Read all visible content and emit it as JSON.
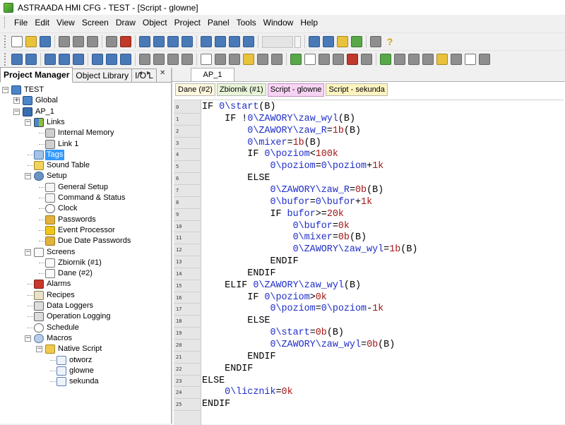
{
  "window": {
    "title": "ASTRAADA HMI CFG - TEST - [Script - glowne]"
  },
  "menu": {
    "items": [
      "File",
      "Edit",
      "View",
      "Screen",
      "Draw",
      "Object",
      "Project",
      "Panel",
      "Tools",
      "Window",
      "Help"
    ]
  },
  "toolbar1": {
    "icons": [
      "new-file-icon",
      "open-folder-icon",
      "save-icon",
      "cut-icon",
      "copy-icon",
      "paste-icon",
      "undo-icon",
      "redo-icon",
      "screen-add-icon",
      "screen-icon",
      "screen-copy-icon",
      "screen-edit-icon",
      "zoom-in-icon",
      "zoom-out-icon",
      "zoom-fit-icon",
      "hand-icon",
      "zoom-combo",
      "spin-icon",
      "download-icon",
      "upload-icon",
      "edit-icon",
      "simulate-icon",
      "print-icon",
      "help-icon"
    ]
  },
  "toolbar2": {
    "icons": [
      "bold-icon",
      "italic-icon",
      "align-left-icon",
      "align-center-icon",
      "align-right-icon",
      "grid-icon",
      "layer-icon",
      "group-icon",
      "line-icon",
      "rect-icon",
      "ellipse-icon",
      "polygon-icon",
      "text-icon",
      "button-icon",
      "switch-icon",
      "lamp-icon",
      "bar-icon",
      "gauge-icon",
      "trend-icon",
      "bitmap-icon",
      "numeric-icon",
      "ascii-icon",
      "alarm-icon",
      "recipe-icon",
      "chart-icon",
      "slider-icon",
      "knob-icon",
      "table-icon",
      "note-icon",
      "dropdown-icon",
      "picture-icon",
      "video-icon"
    ]
  },
  "left_panel": {
    "tabs": [
      "Project Manager",
      "Object Library",
      "I/O L"
    ],
    "nav_left": "◂",
    "nav_right": "▸",
    "nav_close": "✕",
    "tree": [
      {
        "label": "TEST",
        "level": 0,
        "icon": "network",
        "expander": "−"
      },
      {
        "label": "Global",
        "level": 1,
        "icon": "network",
        "expander": "+"
      },
      {
        "label": "AP_1",
        "level": 1,
        "icon": "computer",
        "expander": "−"
      },
      {
        "label": "Links",
        "level": 2,
        "icon": "link",
        "expander": "−"
      },
      {
        "label": "Internal Memory",
        "level": 3,
        "icon": "memory"
      },
      {
        "label": "Link 1",
        "level": 3,
        "icon": "memory"
      },
      {
        "label": "Tags",
        "level": 2,
        "icon": "tag",
        "selected": true
      },
      {
        "label": "Sound Table",
        "level": 2,
        "icon": "sound"
      },
      {
        "label": "Setup",
        "level": 2,
        "icon": "gear",
        "expander": "−"
      },
      {
        "label": "General Setup",
        "level": 3,
        "icon": "settings"
      },
      {
        "label": "Command & Status",
        "level": 3,
        "icon": "settings"
      },
      {
        "label": "Clock",
        "level": 3,
        "icon": "clock"
      },
      {
        "label": "Passwords",
        "level": 3,
        "icon": "key"
      },
      {
        "label": "Event Processor",
        "level": 3,
        "icon": "event"
      },
      {
        "label": "Due Date Passwords",
        "level": 3,
        "icon": "key"
      },
      {
        "label": "Screens",
        "level": 2,
        "icon": "screen",
        "expander": "−"
      },
      {
        "label": "Zbiornik (#1)",
        "level": 3,
        "icon": "screen"
      },
      {
        "label": "Dane (#2)",
        "level": 3,
        "icon": "screen"
      },
      {
        "label": "Alarms",
        "level": 2,
        "icon": "alarm"
      },
      {
        "label": "Recipes",
        "level": 2,
        "icon": "recipe"
      },
      {
        "label": "Data Loggers",
        "level": 2,
        "icon": "log"
      },
      {
        "label": "Operation Logging",
        "level": 2,
        "icon": "log"
      },
      {
        "label": "Schedule",
        "level": 2,
        "icon": "schedule"
      },
      {
        "label": "Macros",
        "level": 2,
        "icon": "macro",
        "expander": "−"
      },
      {
        "label": "Native Script",
        "level": 3,
        "icon": "native",
        "expander": "−"
      },
      {
        "label": "otworz",
        "level": 4,
        "icon": "script"
      },
      {
        "label": "glowne",
        "level": 4,
        "icon": "script"
      },
      {
        "label": "sekunda",
        "level": 4,
        "icon": "script"
      }
    ]
  },
  "document": {
    "tab": "AP_1",
    "script_tabs": [
      {
        "label": "Dane (#2)",
        "active": false,
        "bg": "#fff8e0"
      },
      {
        "label": "Zbiornik (#1)",
        "active": false,
        "bg": "#e8f4d8"
      },
      {
        "label": "Script - glowne",
        "active": true,
        "bg": "#f8d4f4"
      },
      {
        "label": "Script - sekunda",
        "active": false,
        "bg": "#fff4c0"
      }
    ]
  },
  "editor": {
    "lines": [
      {
        "n": "0",
        "indent": "",
        "tokens": [
          [
            "kw",
            "IF "
          ],
          [
            "vr",
            "0\\start"
          ],
          [
            "op",
            "(B)"
          ]
        ]
      },
      {
        "n": "1",
        "indent": "    ",
        "tokens": [
          [
            "kw",
            "IF !"
          ],
          [
            "vr",
            "0\\ZAWORY\\zaw_wyl"
          ],
          [
            "op",
            "(B)"
          ]
        ]
      },
      {
        "n": "2",
        "indent": "        ",
        "tokens": [
          [
            "vr",
            "0\\ZAWORY\\zaw_R"
          ],
          [
            "op",
            "="
          ],
          [
            "nm",
            "1b"
          ],
          [
            "op",
            "(B)"
          ]
        ]
      },
      {
        "n": "3",
        "indent": "        ",
        "tokens": [
          [
            "vr",
            "0\\mixer"
          ],
          [
            "op",
            "="
          ],
          [
            "nm",
            "1b"
          ],
          [
            "op",
            "(B)"
          ]
        ]
      },
      {
        "n": "4",
        "indent": "        ",
        "tokens": [
          [
            "kw",
            "IF "
          ],
          [
            "vr",
            "0\\poziom"
          ],
          [
            "op",
            "<"
          ],
          [
            "nm",
            "100k"
          ]
        ]
      },
      {
        "n": "5",
        "indent": "            ",
        "tokens": [
          [
            "vr",
            "0\\poziom"
          ],
          [
            "op",
            "="
          ],
          [
            "vr",
            "0\\poziom"
          ],
          [
            "op",
            "+"
          ],
          [
            "nm",
            "1k"
          ]
        ]
      },
      {
        "n": "6",
        "indent": "        ",
        "tokens": [
          [
            "kw",
            "ELSE"
          ]
        ]
      },
      {
        "n": "7",
        "indent": "            ",
        "tokens": [
          [
            "vr",
            "0\\ZAWORY\\zaw_R"
          ],
          [
            "op",
            "="
          ],
          [
            "nm",
            "0b"
          ],
          [
            "op",
            "(B)"
          ]
        ]
      },
      {
        "n": "8",
        "indent": "            ",
        "tokens": [
          [
            "vr",
            "0\\bufor"
          ],
          [
            "op",
            "="
          ],
          [
            "vr",
            "0\\bufor"
          ],
          [
            "op",
            "+"
          ],
          [
            "nm",
            "1k"
          ]
        ]
      },
      {
        "n": "9",
        "indent": "            ",
        "tokens": [
          [
            "kw",
            "IF "
          ],
          [
            "vr",
            "bufor"
          ],
          [
            "op",
            ">="
          ],
          [
            "nm",
            "20k"
          ]
        ]
      },
      {
        "n": "10",
        "indent": "                ",
        "tokens": [
          [
            "vr",
            "0\\bufor"
          ],
          [
            "op",
            "="
          ],
          [
            "nm",
            "0k"
          ]
        ]
      },
      {
        "n": "11",
        "indent": "                ",
        "tokens": [
          [
            "vr",
            "0\\mixer"
          ],
          [
            "op",
            "="
          ],
          [
            "nm",
            "0b"
          ],
          [
            "op",
            "(B)"
          ]
        ]
      },
      {
        "n": "12",
        "indent": "                ",
        "tokens": [
          [
            "vr",
            "0\\ZAWORY\\zaw_wyl"
          ],
          [
            "op",
            "="
          ],
          [
            "nm",
            "1b"
          ],
          [
            "op",
            "(B)"
          ]
        ]
      },
      {
        "n": "13",
        "indent": "            ",
        "tokens": [
          [
            "kw",
            "ENDIF"
          ]
        ]
      },
      {
        "n": "14",
        "indent": "        ",
        "tokens": [
          [
            "kw",
            "ENDIF"
          ]
        ]
      },
      {
        "n": "15",
        "indent": "    ",
        "tokens": [
          [
            "kw",
            "ELIF "
          ],
          [
            "vr",
            "0\\ZAWORY\\zaw_wyl"
          ],
          [
            "op",
            "(B)"
          ]
        ]
      },
      {
        "n": "16",
        "indent": "        ",
        "tokens": [
          [
            "kw",
            "IF "
          ],
          [
            "vr",
            "0\\poziom"
          ],
          [
            "op",
            ">"
          ],
          [
            "nm",
            "0k"
          ]
        ]
      },
      {
        "n": "17",
        "indent": "            ",
        "tokens": [
          [
            "vr",
            "0\\poziom"
          ],
          [
            "op",
            "="
          ],
          [
            "vr",
            "0\\poziom"
          ],
          [
            "op",
            "-"
          ],
          [
            "nm",
            "1k"
          ]
        ]
      },
      {
        "n": "18",
        "indent": "        ",
        "tokens": [
          [
            "kw",
            "ELSE"
          ]
        ]
      },
      {
        "n": "19",
        "indent": "            ",
        "tokens": [
          [
            "vr",
            "0\\start"
          ],
          [
            "op",
            "="
          ],
          [
            "nm",
            "0b"
          ],
          [
            "op",
            "(B)"
          ]
        ]
      },
      {
        "n": "20",
        "indent": "            ",
        "tokens": [
          [
            "vr",
            "0\\ZAWORY\\zaw_wyl"
          ],
          [
            "op",
            "="
          ],
          [
            "nm",
            "0b"
          ],
          [
            "op",
            "(B)"
          ]
        ]
      },
      {
        "n": "21",
        "indent": "        ",
        "tokens": [
          [
            "kw",
            "ENDIF"
          ]
        ]
      },
      {
        "n": "22",
        "indent": "    ",
        "tokens": [
          [
            "kw",
            "ENDIF"
          ]
        ]
      },
      {
        "n": "23",
        "indent": "",
        "tokens": [
          [
            "kw",
            "ELSE"
          ]
        ]
      },
      {
        "n": "24",
        "indent": "    ",
        "tokens": [
          [
            "vr",
            "0\\licznik"
          ],
          [
            "op",
            "="
          ],
          [
            "nm",
            "0k"
          ]
        ]
      },
      {
        "n": "25",
        "indent": "",
        "tokens": [
          [
            "kw",
            "ENDIF"
          ]
        ]
      }
    ]
  }
}
